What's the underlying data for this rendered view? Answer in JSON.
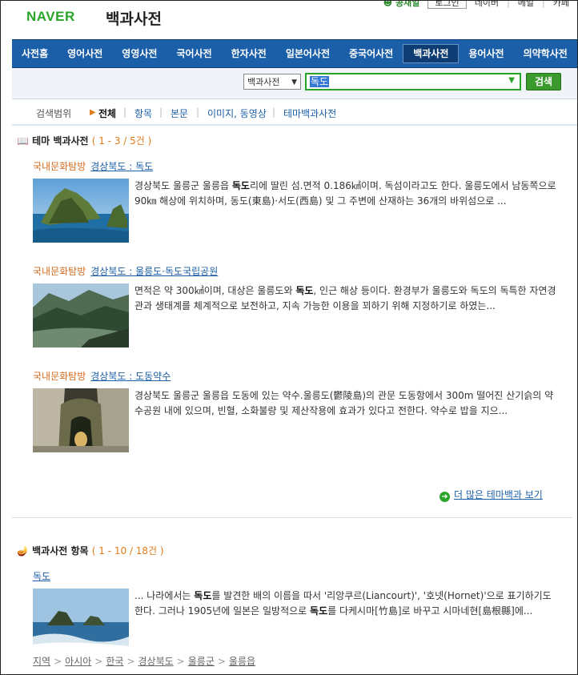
{
  "header": {
    "logo": "NAVER",
    "title": "백과사전",
    "gongjeil": "공채일",
    "login": "로그인",
    "links": [
      "네이버",
      "메일",
      "카페"
    ]
  },
  "nav": [
    "사전홈",
    "영어사전",
    "영영사전",
    "국어사전",
    "한자사전",
    "일본어사전",
    "중국어사전",
    "백과사전",
    "용어사전",
    "의약학사전"
  ],
  "search": {
    "select": "백과사전",
    "value": "독도",
    "button": "검색"
  },
  "filters": {
    "label": "검색범위",
    "items": [
      "전체",
      "항목",
      "본문",
      "이미지, 동영상",
      "테마백과사전"
    ]
  },
  "theme": {
    "title": "테마 백과사전",
    "count": "( 1 - 3 / 5건 )",
    "items": [
      {
        "category": "국내문화탐방",
        "title": "경상북도 : 독도",
        "desc": [
          "경상북도 울릉군 울릉읍 ",
          "독도",
          "리에 딸린 섬.면적 0.186㎢이며. 독섬이라고도 한다. 울릉도에서 남동쪽으로 90㎞ 해상에 위치하며, 동도(東島)·서도(西島) 및 그 주변에 산재하는 36개의 바위섬으로 ..."
        ]
      },
      {
        "category": "국내문화탐방",
        "title": "경상북도 : 울릉도·독도국립공원",
        "desc": [
          "면적은 약 300㎢이며, 대상은 울릉도와 ",
          "독도",
          ", 인근 해상 등이다. 환경부가 울릉도와 독도의 독특한 자연경관과 생태계를 체계적으로 보전하고, 지속 가능한 이용을 꾀하기 위해 지정하기로 하였는..."
        ]
      },
      {
        "category": "국내문화탐방",
        "title": "경상북도 : 도동약수",
        "desc": [
          "경상북도 울릉군 울릉읍 도동에 있는 약수.울릉도(鬱陵島)의 관문 도동항에서 300m 떨어진 산기슭의 약수공원 내에 있으며, 빈혈, 소화불량 및 제산작용에 효과가 있다고 전한다. 약수로 밥을 지으...",
          "",
          ""
        ]
      }
    ],
    "more": "더 많은 테마백과 보기"
  },
  "encyclopedia": {
    "title": "백과사전 항목",
    "count": "( 1 - 10 / 18건 )",
    "item": {
      "title": "독도",
      "desc": [
        "... 나라에서는 ",
        "독도",
        "를 발견한 배의 이름을 따서 '리앙쿠르(Liancourt)', '호넷(Hornet)'으로 표기하기도 한다. 그러나 1905년에 일본은 일방적으로 ",
        "독도",
        "를 다케시마[竹島]로 바꾸고 시마네현[島根縣]에..."
      ]
    },
    "breadcrumb": [
      "지역",
      "아시아",
      "한국",
      "경상북도",
      "울릉군",
      "울릉읍"
    ]
  }
}
